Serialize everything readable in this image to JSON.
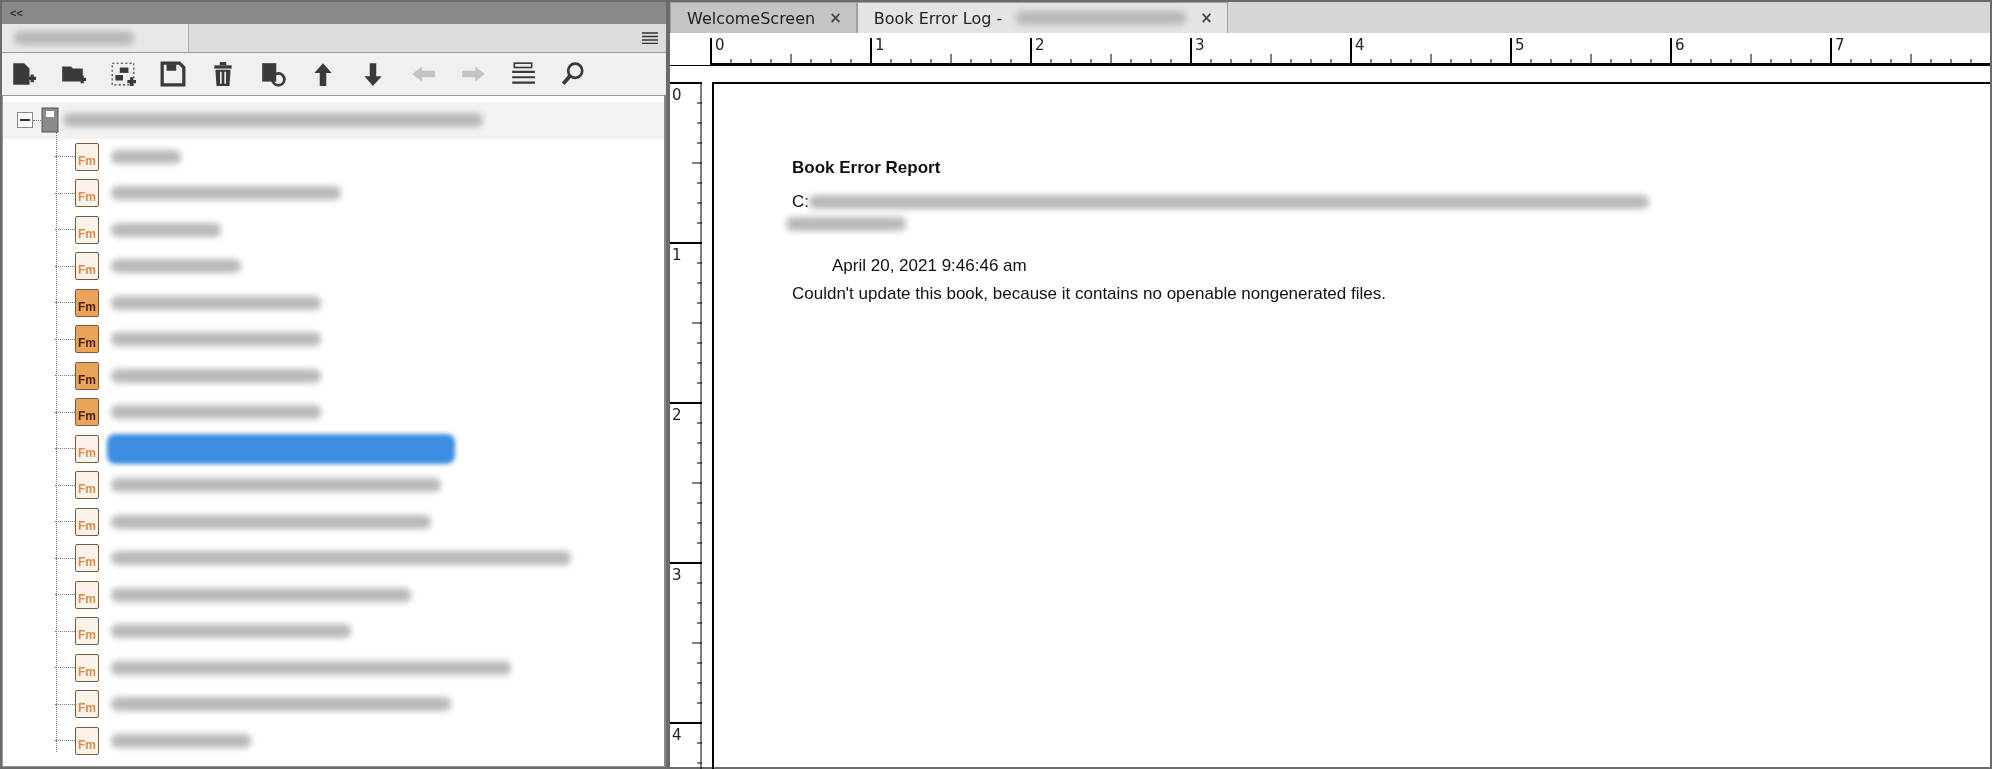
{
  "left_panel": {
    "collapse": "<<",
    "toolbar": [
      {
        "kind": "new-file",
        "disabled": false
      },
      {
        "kind": "new-folder",
        "disabled": false
      },
      {
        "kind": "new-group",
        "disabled": false
      },
      {
        "kind": "save",
        "disabled": false
      },
      {
        "kind": "delete",
        "disabled": false
      },
      {
        "kind": "update",
        "disabled": false
      },
      {
        "kind": "up",
        "disabled": false
      },
      {
        "kind": "down",
        "disabled": false
      },
      {
        "kind": "left",
        "disabled": true
      },
      {
        "kind": "right",
        "disabled": true
      },
      {
        "kind": "list",
        "disabled": false
      },
      {
        "kind": "search",
        "disabled": false
      }
    ],
    "tree": {
      "expanded": true,
      "children": [
        {
          "kind": "plain",
          "icon_text": "Fm",
          "selected": false
        },
        {
          "kind": "plain",
          "icon_text": "Fm",
          "selected": false
        },
        {
          "kind": "plain",
          "icon_text": "Fm",
          "selected": false
        },
        {
          "kind": "plain",
          "icon_text": "Fm",
          "selected": false
        },
        {
          "kind": "filled",
          "icon_text": "Fm",
          "selected": false
        },
        {
          "kind": "filled",
          "icon_text": "Fm",
          "selected": false
        },
        {
          "kind": "filled",
          "icon_text": "Fm",
          "selected": false
        },
        {
          "kind": "filled",
          "icon_text": "Fm",
          "selected": false
        },
        {
          "kind": "plain",
          "icon_text": "Fm",
          "selected": true
        },
        {
          "kind": "plain",
          "icon_text": "Fm",
          "selected": false
        },
        {
          "kind": "plain",
          "icon_text": "Fm",
          "selected": false
        },
        {
          "kind": "plain",
          "icon_text": "Fm",
          "selected": false
        },
        {
          "kind": "plain",
          "icon_text": "Fm",
          "selected": false
        },
        {
          "kind": "plain",
          "icon_text": "Fm",
          "selected": false
        },
        {
          "kind": "plain",
          "icon_text": "Fm",
          "selected": false
        },
        {
          "kind": "plain",
          "icon_text": "Fm",
          "selected": false
        },
        {
          "kind": "plain",
          "icon_text": "Fm",
          "selected": false
        }
      ]
    }
  },
  "tabs": [
    {
      "label": "WelcomeScreen",
      "close": "×",
      "selected": false
    },
    {
      "label": "Book Error Log -",
      "close": "×",
      "selected": true
    }
  ],
  "ruler": {
    "horizontal": [
      "0",
      "1",
      "2",
      "3",
      "4",
      "5",
      "6",
      "7"
    ],
    "vertical": [
      "0",
      "1",
      "2",
      "3",
      "4"
    ]
  },
  "document": {
    "title": "Book Error Report",
    "path_prefix": "C:",
    "date": "April 20, 2021 9:46:46 am",
    "message": "Couldn't update this book, because it contains no openable nongenerated files."
  }
}
